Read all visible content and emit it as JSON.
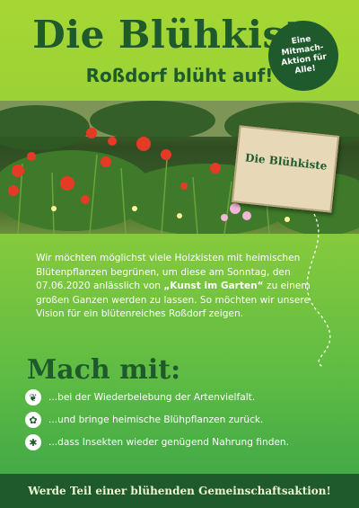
{
  "header": {
    "title": "Die Blühkiste",
    "subtitle": "Roßdorf blüht auf!"
  },
  "badge": {
    "text": "Eine\nMitmach-\nAktion für\nAlle!"
  },
  "crate": {
    "label": "Die Blühkiste"
  },
  "intro": {
    "text_before": "Wir möchten möglichst viele Holzkisten mit heimischen Blütenpflanzen begrünen, um diese am Sonntag, den 07.06.2020 anlässlich von ",
    "highlight": "„Kunst im Garten“",
    "text_after": " zu einem großen Ganzen werden zu lassen. So möchten wir unsere Vision für ein blütenreiches Roßdorf zeigen."
  },
  "mach_mit": {
    "heading": "Mach mit:",
    "items": [
      {
        "icon": "plant-icon",
        "text": "...bei der Wiederbelebung der Artenvielfalt."
      },
      {
        "icon": "flower-icon",
        "text": "...und bringe heimische Blühpflanzen zurück."
      },
      {
        "icon": "insect-icon",
        "text": "...dass Insekten wieder genügend Nahrung finden."
      }
    ]
  },
  "footer": {
    "text": "Werde Teil einer blühenden Gemeinschaftsaktion!"
  },
  "colors": {
    "dark_green": "#1f5a2c",
    "light_green": "#a6d733",
    "mid_green": "#5dbb44",
    "poppy": "#e53a26"
  }
}
